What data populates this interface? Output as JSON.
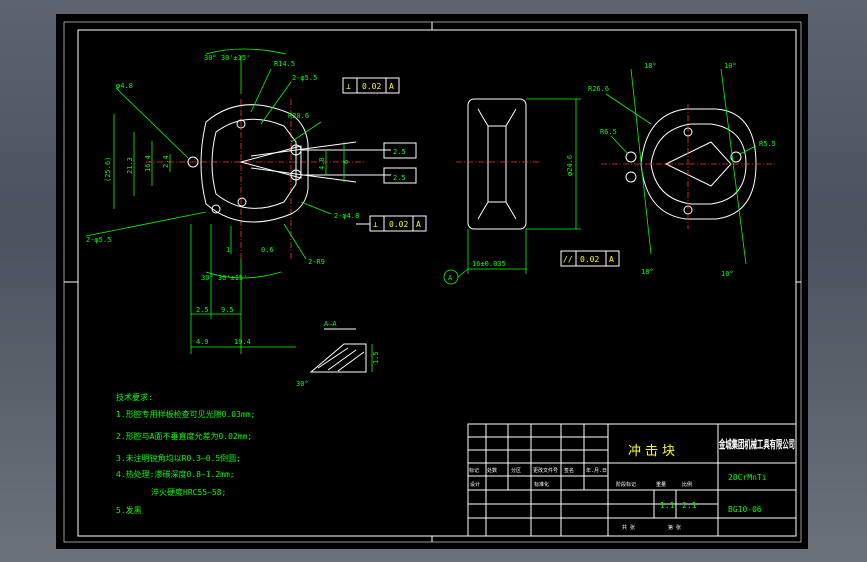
{
  "dimensions": {
    "angle_top": "30° 30'±15'",
    "r14_5": "R14.5",
    "two_phi5_5": "2-φ5.5",
    "r20": "R20.6",
    "phi4_8": "φ4.8",
    "dim_25": "(25.6)",
    "dim_21_3": "21.3",
    "dim_16_4": "16.4",
    "dim_2_4": "2.4",
    "dim_4_8": "4.8",
    "dim_6": "6",
    "dim_0_6": "0.6",
    "dim_1": "1",
    "two_phi5_5_b": "2-φ5.5",
    "two_phi4_8": "2-φ4.8",
    "two_r9": "2-R9",
    "angle_bottom": "30° 30'±15'",
    "dim_2_5": "2.5",
    "dim_9_5": "9.5",
    "dim_4_9": "4.9",
    "dim_19_4": "19.4",
    "dim_16": "16±0.035",
    "dim_phi24": "φ24.6",
    "tilt_18": "18°",
    "tilt_10": "10°",
    "r26": "R26.6",
    "r6_5": "R6.5",
    "r5_5": "R5.5",
    "section_label": "A—A",
    "section_angle": "30°",
    "section_dim": "1.5",
    "datum": "A",
    "notch_w": "2.5",
    "notch_w2": "2.5"
  },
  "tolerances": {
    "perp1_symbol": "⊥",
    "perp1_value": "0.02",
    "perp1_datum": "A",
    "perp2_symbol": "⊥",
    "perp2_value": "0.02",
    "perp2_datum": "A",
    "par_symbol": "//",
    "par_value": "0.02",
    "par_datum": "A"
  },
  "requirements": {
    "title": "技术要求:",
    "items": [
      "1.形腔专用样板检查可见光隙0.03mm;",
      "2.形腔与A面不垂直度允差为0.02mm;",
      "3.未注明锐角均以R0.3—0.5倒圆;",
      "4.热处理:渗碳深度0.8—1.2mm;",
      "淬火硬度HRC55—58;",
      "5.发黑"
    ]
  },
  "title_block": {
    "part_name": "冲击块",
    "company": "金城集团机械工具有限公司",
    "material": "20CrMnTi",
    "drawing_no": "BG10-06",
    "scale_label": "1:1",
    "scale_value": "2:1",
    "label_mark": "标记",
    "label_count": "处数",
    "label_zone": "分区",
    "label_change": "更改文件号",
    "label_sign": "签名",
    "label_date": "年.月.日",
    "label_design": "设计",
    "label_std": "标准化",
    "label_stage": "阶段标记",
    "label_weight": "重量",
    "label_ratio": "比例",
    "label_sheets": "共 张",
    "label_sheet": "第 张"
  }
}
